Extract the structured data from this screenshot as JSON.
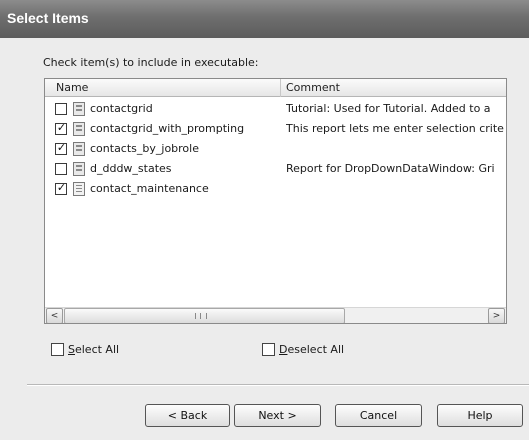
{
  "dialog": {
    "title": "Select Items",
    "instruction": "Check item(s) to include in executable:"
  },
  "listview": {
    "columns": {
      "name": "Name",
      "comment": "Comment"
    },
    "rows": [
      {
        "name": "contactgrid",
        "comment": "Tutorial: Used for Tutorial. Added to a",
        "checked": false,
        "icon": "report-icon"
      },
      {
        "name": "contactgrid_with_prompting",
        "comment": "This report lets me enter selection crite",
        "checked": true,
        "icon": "report-icon"
      },
      {
        "name": "contacts_by_jobrole",
        "comment": "",
        "checked": true,
        "icon": "report-icon"
      },
      {
        "name": "d_dddw_states",
        "comment": "Report for DropDownDataWindow: Gri",
        "checked": false,
        "icon": "report-icon"
      },
      {
        "name": "contact_maintenance",
        "comment": "",
        "checked": true,
        "icon": "form-icon"
      }
    ],
    "scroll_left_glyph": "<",
    "scroll_right_glyph": ">"
  },
  "select_all": {
    "label": "Select All",
    "underline": "S",
    "rest": "elect All"
  },
  "deselect_all": {
    "label": "Deselect All",
    "underline": "D",
    "rest": "eselect All"
  },
  "buttons": {
    "back": "< Back",
    "next": "Next >",
    "cancel": "Cancel",
    "help": "Help"
  }
}
